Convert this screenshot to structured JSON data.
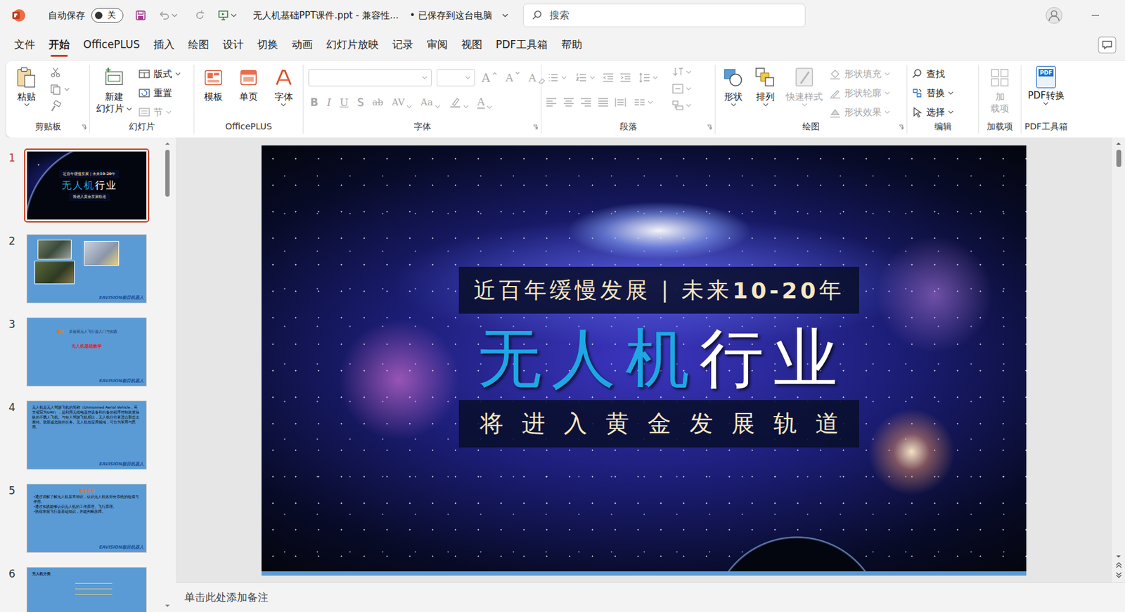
{
  "window": {
    "autosave_label": "自动保存",
    "autosave_state": "关",
    "autosave_on": false,
    "title": "无人机基础PPT课件.ppt  -  兼容性...",
    "save_status": "•  已保存到这台电脑"
  },
  "search": {
    "placeholder": "搜索"
  },
  "menu": [
    {
      "label": "文件",
      "selected": false
    },
    {
      "label": "开始",
      "selected": true
    },
    {
      "label": "OfficePLUS",
      "selected": false
    },
    {
      "label": "插入",
      "selected": false
    },
    {
      "label": "绘图",
      "selected": false
    },
    {
      "label": "设计",
      "selected": false
    },
    {
      "label": "切换",
      "selected": false
    },
    {
      "label": "动画",
      "selected": false
    },
    {
      "label": "幻灯片放映",
      "selected": false
    },
    {
      "label": "记录",
      "selected": false
    },
    {
      "label": "审阅",
      "selected": false
    },
    {
      "label": "视图",
      "selected": false
    },
    {
      "label": "PDF工具箱",
      "selected": false
    },
    {
      "label": "帮助",
      "selected": false
    }
  ],
  "ribbon": {
    "clipboard": {
      "label": "剪贴板",
      "paste": "粘贴"
    },
    "slides": {
      "label": "幻灯片",
      "new_slide": [
        "新建",
        "幻灯片"
      ],
      "items": [
        {
          "label": "版式",
          "disabled": false
        },
        {
          "label": "重置",
          "disabled": false
        },
        {
          "label": "节",
          "disabled": true
        }
      ]
    },
    "officeplus": {
      "label": "OfficePLUS",
      "items": [
        {
          "label": "模板"
        },
        {
          "label": "单页"
        },
        {
          "label": "字体"
        }
      ]
    },
    "font": {
      "label": "字体",
      "disabled": true,
      "grow": "A",
      "shrink": "A",
      "clear": "A",
      "format": [
        {
          "text": "B",
          "kind": "bold"
        },
        {
          "text": "I",
          "kind": "italic"
        },
        {
          "text": "U",
          "kind": "underline"
        },
        {
          "text": "S",
          "kind": "shadow"
        },
        {
          "text": "ab",
          "kind": "strike"
        },
        {
          "text": "AV",
          "kind": "spacing"
        },
        {
          "text": "Aa",
          "kind": "case"
        }
      ],
      "color_letter": "A"
    },
    "paragraph": {
      "label": "段落",
      "disabled": true
    },
    "drawing": {
      "label": "绘图",
      "large": [
        {
          "label": "形状",
          "disabled": false
        },
        {
          "label": "排列",
          "disabled": false
        },
        {
          "label": "快速样式",
          "disabled": true
        }
      ],
      "small": [
        {
          "label": "形状填充",
          "disabled": true
        },
        {
          "label": "形状轮廓",
          "disabled": true
        },
        {
          "label": "形状效果",
          "disabled": true
        }
      ]
    },
    "editing": {
      "label": "编辑",
      "items": [
        {
          "label": "查找"
        },
        {
          "label": "替换"
        },
        {
          "label": "选择"
        }
      ]
    },
    "addins": {
      "label": "加载项",
      "button": [
        "加",
        "载项"
      ],
      "disabled": true
    },
    "pdf": {
      "label": "PDF工具箱",
      "button": "PDF转换",
      "icon_text": "PDF"
    }
  },
  "slides": [
    {
      "number": "1",
      "selected": true,
      "kind": "cover"
    },
    {
      "number": "2",
      "selected": false,
      "kind": "photos",
      "logo": "EAVISION极目机器人"
    },
    {
      "number": "3",
      "selected": false,
      "kind": "title",
      "lead": "项目一",
      "heading": "多旋翼无人飞行器入门与实践",
      "subheading": "无人机基础教学",
      "logo": "EAVISION极目机器人"
    },
    {
      "number": "4",
      "selected": false,
      "kind": "text",
      "body": "无人机是无人驾驶飞机的简称（Unmanned Aerial Vehicle，英文缩写为UAV），是利用无线电遥控设备和自备的程序控制装置操纵的不载人飞机。与有人驾驶飞机相比，无人机往往更适合那些太愚钝、肮脏或危险的任务。无人机按应用领域，可分为军用与民用。",
      "logo": "EAVISION极目机器人"
    },
    {
      "number": "5",
      "selected": false,
      "kind": "list",
      "heading": "教学目标",
      "bullets": [
        "•通过讲解了解无人机基本知识，认识无人机各部分系统的组成与作用。",
        "•通过实践能够认识无人机的工作原理、飞行原理。",
        "•熟练掌握飞行器基础知识，并能判断故障。"
      ],
      "logo": "EAVISION极目机器人"
    },
    {
      "number": "6",
      "selected": false,
      "kind": "chart",
      "heading": "无人机分类"
    }
  ],
  "editor": {
    "top_line": [
      {
        "text": "近百年缓慢发展 | 未来",
        "bold": false
      },
      {
        "text": "10-20",
        "bold": true
      },
      {
        "text": "年",
        "bold": false
      }
    ],
    "title": [
      {
        "text": "无人机",
        "color": "#1ea7e4"
      },
      {
        "text": "行业",
        "color": "#ffffff"
      }
    ],
    "tagline": "将进入黄金发展轨道"
  },
  "notes": {
    "placeholder": "单击此处添加备注"
  }
}
